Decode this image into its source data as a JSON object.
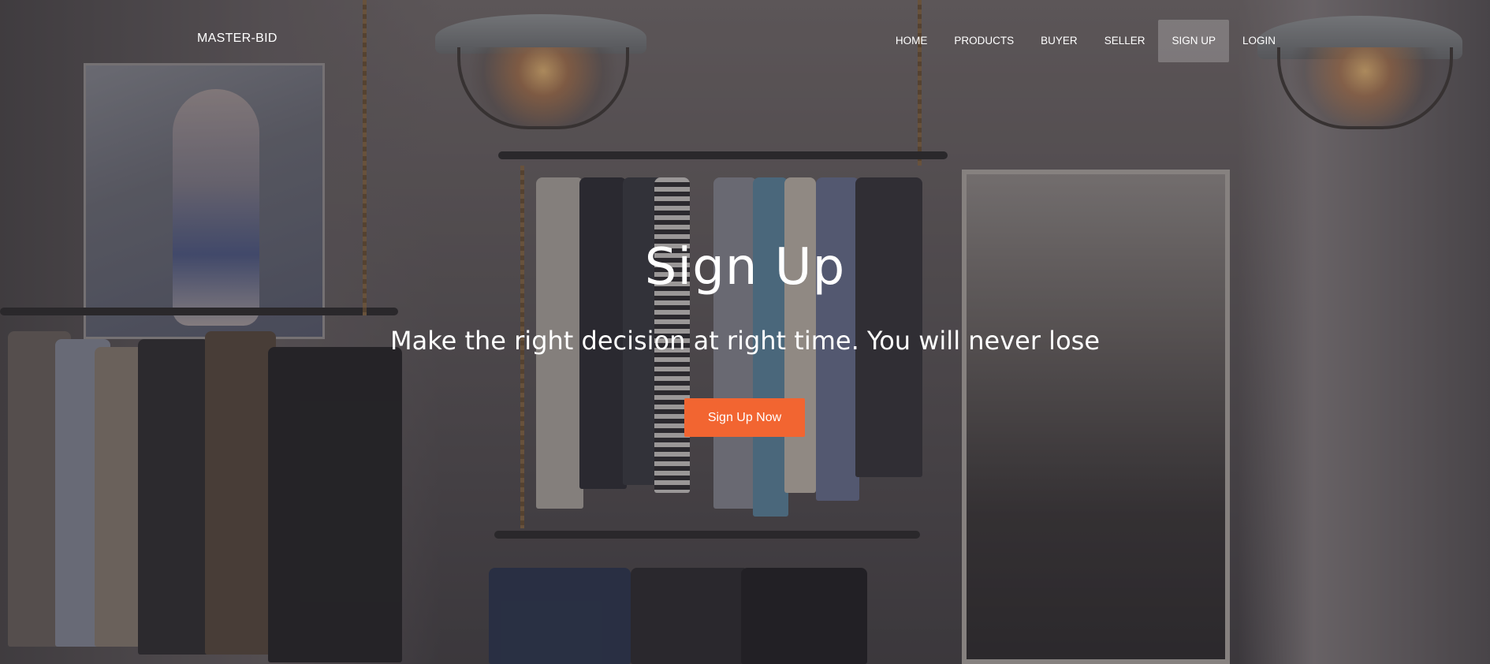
{
  "brand": "MASTER-BID",
  "nav": {
    "items": [
      {
        "label": "HOME"
      },
      {
        "label": "PRODUCTS"
      },
      {
        "label": "BUYER"
      },
      {
        "label": "SELLER"
      },
      {
        "label": "SIGN UP",
        "active": true
      },
      {
        "label": "LOGIN"
      }
    ]
  },
  "hero": {
    "title": "Sign Up",
    "subtitle": "Make the right decision at right time. You will never lose",
    "cta_label": "Sign Up Now"
  },
  "colors": {
    "accent": "#f26531",
    "text": "#ffffff"
  }
}
